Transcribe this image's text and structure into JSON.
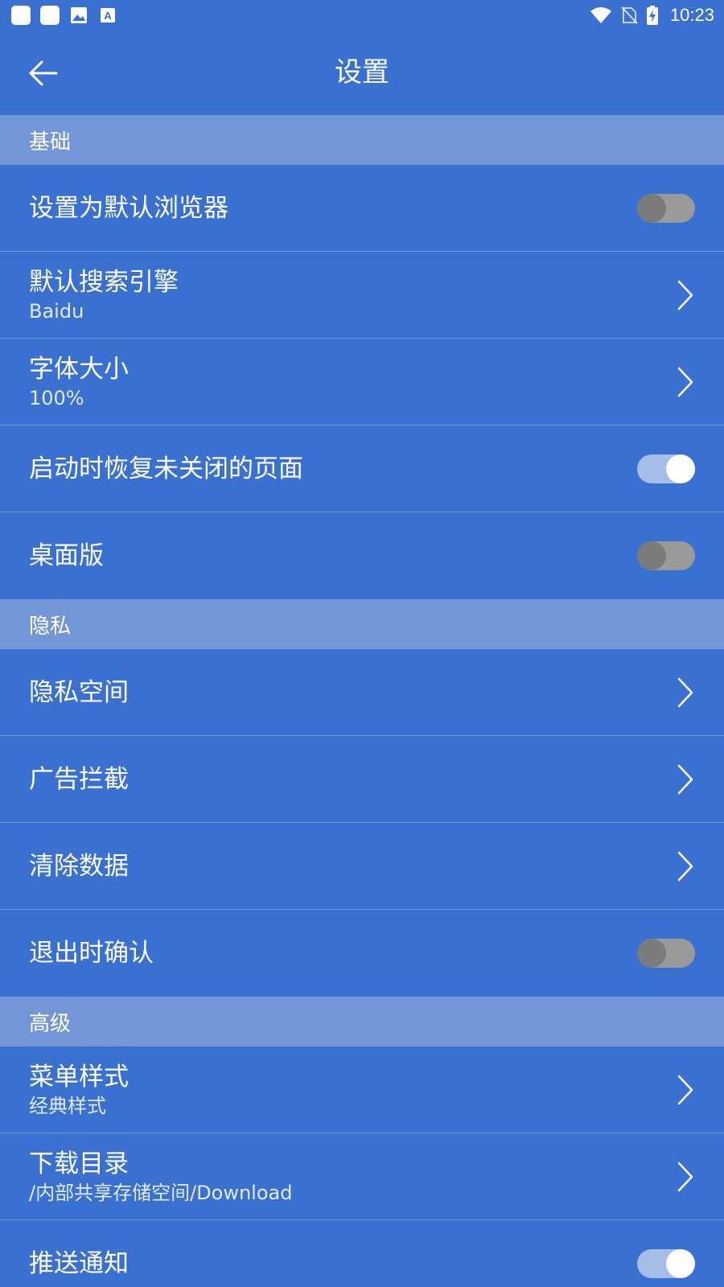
{
  "status_bar": {
    "time": "10:23",
    "notification_icons": [
      "app-notification-icon",
      "app-notification-icon",
      "image-icon",
      "text-a-icon"
    ],
    "status_icons": [
      "wifi-icon",
      "no-sim-icon",
      "battery-charging-icon"
    ]
  },
  "toolbar": {
    "title": "设置",
    "back_icon": "arrow-left-icon"
  },
  "sections": [
    {
      "header": "基础",
      "items": [
        {
          "title": "设置为默认浏览器",
          "subtitle": "",
          "control": "toggle",
          "on": false
        },
        {
          "title": "默认搜索引擎",
          "subtitle": "Baidu",
          "control": "chevron"
        },
        {
          "title": "字体大小",
          "subtitle": "100%",
          "control": "chevron"
        },
        {
          "title": "启动时恢复未关闭的页面",
          "subtitle": "",
          "control": "toggle",
          "on": true
        },
        {
          "title": "桌面版",
          "subtitle": "",
          "control": "toggle",
          "on": false
        }
      ]
    },
    {
      "header": "隐私",
      "items": [
        {
          "title": "隐私空间",
          "subtitle": "",
          "control": "chevron"
        },
        {
          "title": "广告拦截",
          "subtitle": "",
          "control": "chevron"
        },
        {
          "title": "清除数据",
          "subtitle": "",
          "control": "chevron"
        },
        {
          "title": "退出时确认",
          "subtitle": "",
          "control": "toggle",
          "on": false
        }
      ]
    },
    {
      "header": "高级",
      "items": [
        {
          "title": "菜单样式",
          "subtitle": "经典样式",
          "control": "chevron"
        },
        {
          "title": "下载目录",
          "subtitle": "/内部共享存储空间/Download",
          "control": "chevron"
        },
        {
          "title": "推送通知",
          "subtitle": "",
          "control": "toggle",
          "on": true
        }
      ]
    }
  ],
  "colors": {
    "background": "#3a70cf",
    "section_header": "#7596d6",
    "toggle_off_track": "#9a9a9a",
    "toggle_off_knob": "#7b7b7b",
    "toggle_on_track": "#a6bde8",
    "toggle_on_knob": "#ffffff"
  }
}
